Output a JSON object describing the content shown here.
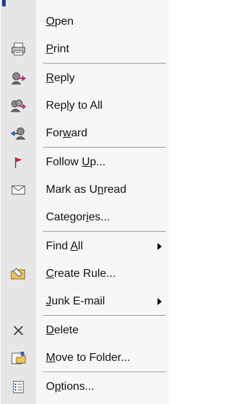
{
  "menu": {
    "items": [
      {
        "label": "Open",
        "mnemonic": "O",
        "icon": "none"
      },
      {
        "label": "Print",
        "mnemonic": "P",
        "icon": "printer-icon"
      },
      {
        "separator": true
      },
      {
        "label": "Reply",
        "mnemonic": "R",
        "icon": "reply-icon"
      },
      {
        "label": "Reply to All",
        "mnemonic": "l",
        "icon": "reply-all-icon"
      },
      {
        "label": "Forward",
        "mnemonic": "w",
        "icon": "forward-icon"
      },
      {
        "separator": true
      },
      {
        "label": "Follow Up...",
        "mnemonic": "U",
        "icon": "flag-icon"
      },
      {
        "label": "Mark as Unread",
        "mnemonic": "n",
        "icon": "envelope-icon"
      },
      {
        "label": "Categories...",
        "mnemonic": "i",
        "icon": "none"
      },
      {
        "separator": true
      },
      {
        "label": "Find All",
        "mnemonic": "A",
        "icon": "none",
        "submenu": true
      },
      {
        "label": "Create Rule...",
        "mnemonic": "C",
        "icon": "create-rule-icon"
      },
      {
        "label": "Junk E-mail",
        "mnemonic": "J",
        "icon": "none",
        "submenu": true
      },
      {
        "separator": true
      },
      {
        "label": "Delete",
        "mnemonic": "D",
        "icon": "delete-x-icon"
      },
      {
        "label": "Move to Folder...",
        "mnemonic": "M",
        "icon": "move-folder-icon"
      },
      {
        "separator": true
      },
      {
        "label": "Options...",
        "mnemonic": "p",
        "icon": "options-icon"
      }
    ]
  }
}
